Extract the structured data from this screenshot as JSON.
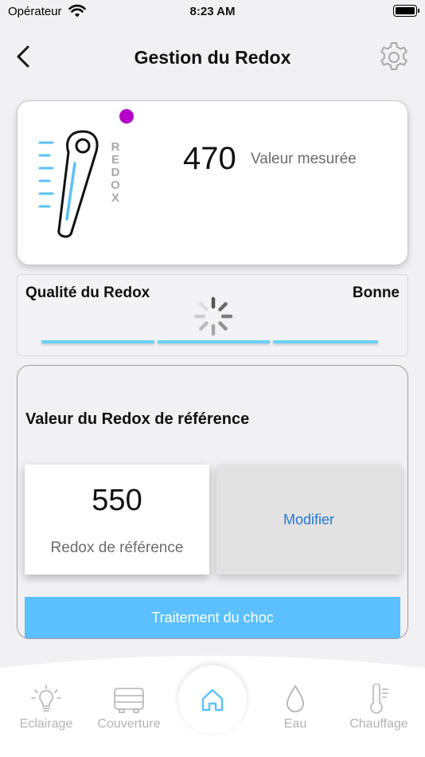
{
  "status_bar": {
    "carrier": "Opérateur",
    "time": "8:23 AM"
  },
  "header": {
    "title": "Gestion du Redox",
    "back_icon": "chevron-left-icon",
    "settings_icon": "gear-icon"
  },
  "measure": {
    "value": "470",
    "label": "Valeur mesurée",
    "probe_letters": "REDOX",
    "status_color": "#b400c8"
  },
  "quality": {
    "title": "Qualité du Redox",
    "value": "Bonne"
  },
  "reference": {
    "title": "Valeur du Redox de référence",
    "value": "550",
    "label": "Redox de référence",
    "modify_label": "Modifier",
    "shock_label": "Traitement du choc"
  },
  "tabs": [
    {
      "label": "Eclairage",
      "icon": "bulb-icon"
    },
    {
      "label": "Couverture",
      "icon": "cover-icon"
    },
    {
      "label": "",
      "icon": "home-icon"
    },
    {
      "label": "Eau",
      "icon": "water-drop-icon"
    },
    {
      "label": "Chauffage",
      "icon": "thermometer-icon"
    }
  ],
  "colors": {
    "accent": "#5bc0fd",
    "link": "#2179d9",
    "probe": "#5bc0fd",
    "quality_bar": "#6bd0f5"
  }
}
